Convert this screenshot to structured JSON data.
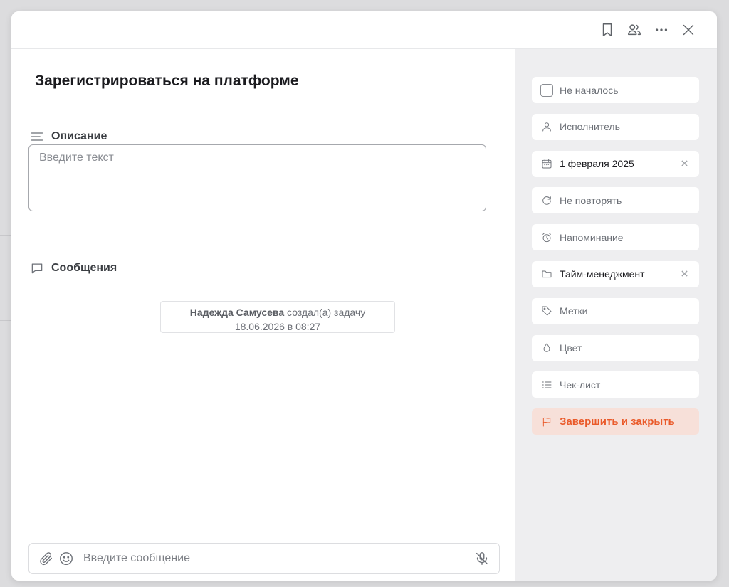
{
  "task": {
    "title": "Зарегистрироваться на платформе"
  },
  "description": {
    "label": "Описание",
    "placeholder": "Введите текст"
  },
  "messages": {
    "label": "Сообщения",
    "system": {
      "author": "Надежда Самусева",
      "action": "создал(а) задачу",
      "timestamp": "18.06.2026 в 08:27"
    }
  },
  "composer": {
    "placeholder": "Введите сообщение"
  },
  "header": {
    "icons": [
      "bookmark-icon",
      "users-icon",
      "more-icon",
      "close-icon"
    ]
  },
  "sidebar": {
    "status": "Не началось",
    "assignee": "Исполнитель",
    "due_date": "1 февраля 2025",
    "repeat": "Не повторять",
    "reminder": "Напоминание",
    "project": "Тайм-менеджмент",
    "tags": "Метки",
    "color": "Цвет",
    "checklist": "Чек-лист",
    "finish": "Завершить и закрыть"
  },
  "colors": {
    "accent": "#ea5a2a",
    "accent_bg": "#f7e0d9",
    "sidebar_bg": "#eeeef0"
  }
}
